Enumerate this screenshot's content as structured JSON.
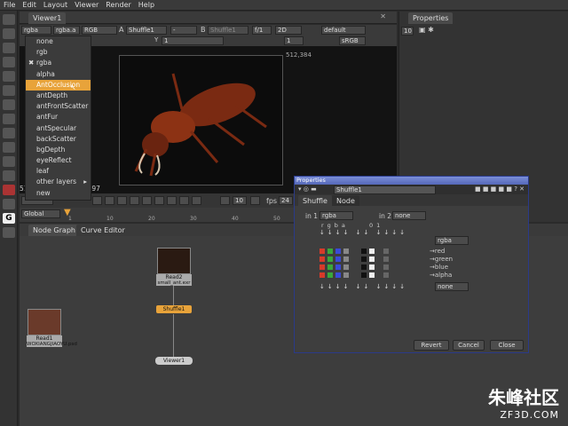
{
  "menu": [
    "File",
    "Edit",
    "Layout",
    "Viewer",
    "Render",
    "Help"
  ],
  "viewer_tab": "Viewer1",
  "properties_tab": "Properties",
  "properties_count": "10",
  "controls": {
    "channels": "rgba",
    "layer": "rgba.a",
    "display": "RGB",
    "a_label": "A",
    "a_input": "Shuffle1",
    "a_op": "-",
    "b_label": "B",
    "b_input": "Shuffle1",
    "gain": "f/1",
    "gain_val": "1",
    "view": "2D",
    "lut": "default",
    "gamma_label": "Y",
    "gamma_val": "1",
    "frame": "1",
    "colorspace": "sRGB"
  },
  "dropdown": {
    "items": [
      "none",
      "rgb",
      "rgba",
      "alpha",
      "AntOcclusion",
      "antDepth",
      "antFrontScatter",
      "antFur",
      "antSpecular",
      "backScatter",
      "bgDepth",
      "eyeReflect",
      "leaf",
      "other layers",
      "new"
    ],
    "checked": "rgba",
    "selected": "AntOcclusion",
    "submenu": "other layers"
  },
  "viewer": {
    "corner_tr": "512,384",
    "status": "512,384  x=-272 y= 397"
  },
  "timebar": {
    "step": "10",
    "fps_label": "fps",
    "fps": "24",
    "range": "Global",
    "ticks": [
      "1",
      "10",
      "20",
      "30",
      "40",
      "50"
    ]
  },
  "graph_tabs": [
    "Node Graph",
    "Curve Editor"
  ],
  "nodes": {
    "read2": "Read2",
    "read2_file": "small_ant.exr",
    "read1": "Read1",
    "read1_file": "WOXIANGJIAOYU.psd",
    "shuffle": "Shuffle1",
    "viewer": "Viewer1"
  },
  "dialog": {
    "title": "Properties",
    "node_name": "Shuffle1",
    "tabs": [
      "Shuffle",
      "Node"
    ],
    "in1_label": "in 1",
    "in1": "rgba",
    "in2_label": "in 2",
    "in2": "none",
    "cols_in1": [
      "r",
      "g",
      "b",
      "a"
    ],
    "cols_const": [
      "0",
      "1"
    ],
    "out_layer": "rgba",
    "outputs": [
      "red",
      "green",
      "blue",
      "alpha"
    ],
    "out2": "none",
    "buttons": [
      "Revert",
      "Cancel",
      "Close"
    ]
  },
  "watermark": {
    "brand": "朱峰社区",
    "url": "ZF3D.COM"
  },
  "colors": {
    "selected": "#e8a33a",
    "dialog_border": "#2a3a8a",
    "red": "#d83a2a",
    "green": "#3aa83a",
    "blue": "#3a4ad8"
  }
}
